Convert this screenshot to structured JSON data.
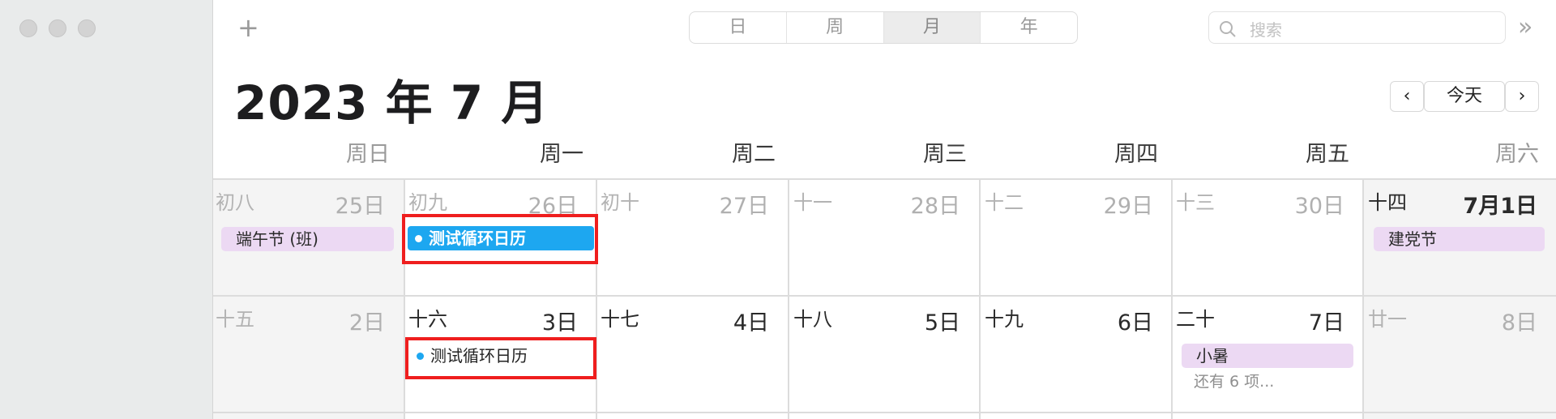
{
  "toolbar": {
    "add_label": "+",
    "views": [
      "日",
      "周",
      "月",
      "年"
    ],
    "active_view": "月",
    "search_placeholder": "搜索",
    "more_label": "»"
  },
  "header": {
    "title": "2023 年 7 月",
    "today_label": "今天",
    "prev_label": "‹",
    "next_label": "›"
  },
  "weekdays": [
    "周日",
    "周一",
    "周二",
    "周三",
    "周四",
    "周五",
    "周六"
  ],
  "weeks": [
    [
      {
        "lunar": "初八",
        "day": "25日",
        "current": false
      },
      {
        "lunar": "初九",
        "day": "26日",
        "current": false
      },
      {
        "lunar": "初十",
        "day": "27日",
        "current": false
      },
      {
        "lunar": "十一",
        "day": "28日",
        "current": false
      },
      {
        "lunar": "十二",
        "day": "29日",
        "current": false
      },
      {
        "lunar": "十三",
        "day": "30日",
        "current": false
      },
      {
        "lunar": "十四",
        "day": "7月1日",
        "current": true
      }
    ],
    [
      {
        "lunar": "十五",
        "day": "2日",
        "current": true
      },
      {
        "lunar": "十六",
        "day": "3日",
        "current": true
      },
      {
        "lunar": "十七",
        "day": "4日",
        "current": true
      },
      {
        "lunar": "十八",
        "day": "5日",
        "current": true
      },
      {
        "lunar": "十九",
        "day": "6日",
        "current": true
      },
      {
        "lunar": "二十",
        "day": "7日",
        "current": true
      },
      {
        "lunar": "廿一",
        "day": "8日",
        "current": true
      }
    ]
  ],
  "events": {
    "duanwu": "端午节 (班)",
    "test_selected": "测试循环日历",
    "jiandang": "建党节",
    "test": "测试循环日历",
    "xiaoshu": "小暑",
    "more_items": "还有 6 项..."
  },
  "colors": {
    "event_blue": "#1da7f0",
    "holiday_purple": "#ecd9f3",
    "highlight_red": "#ef1e1e"
  }
}
